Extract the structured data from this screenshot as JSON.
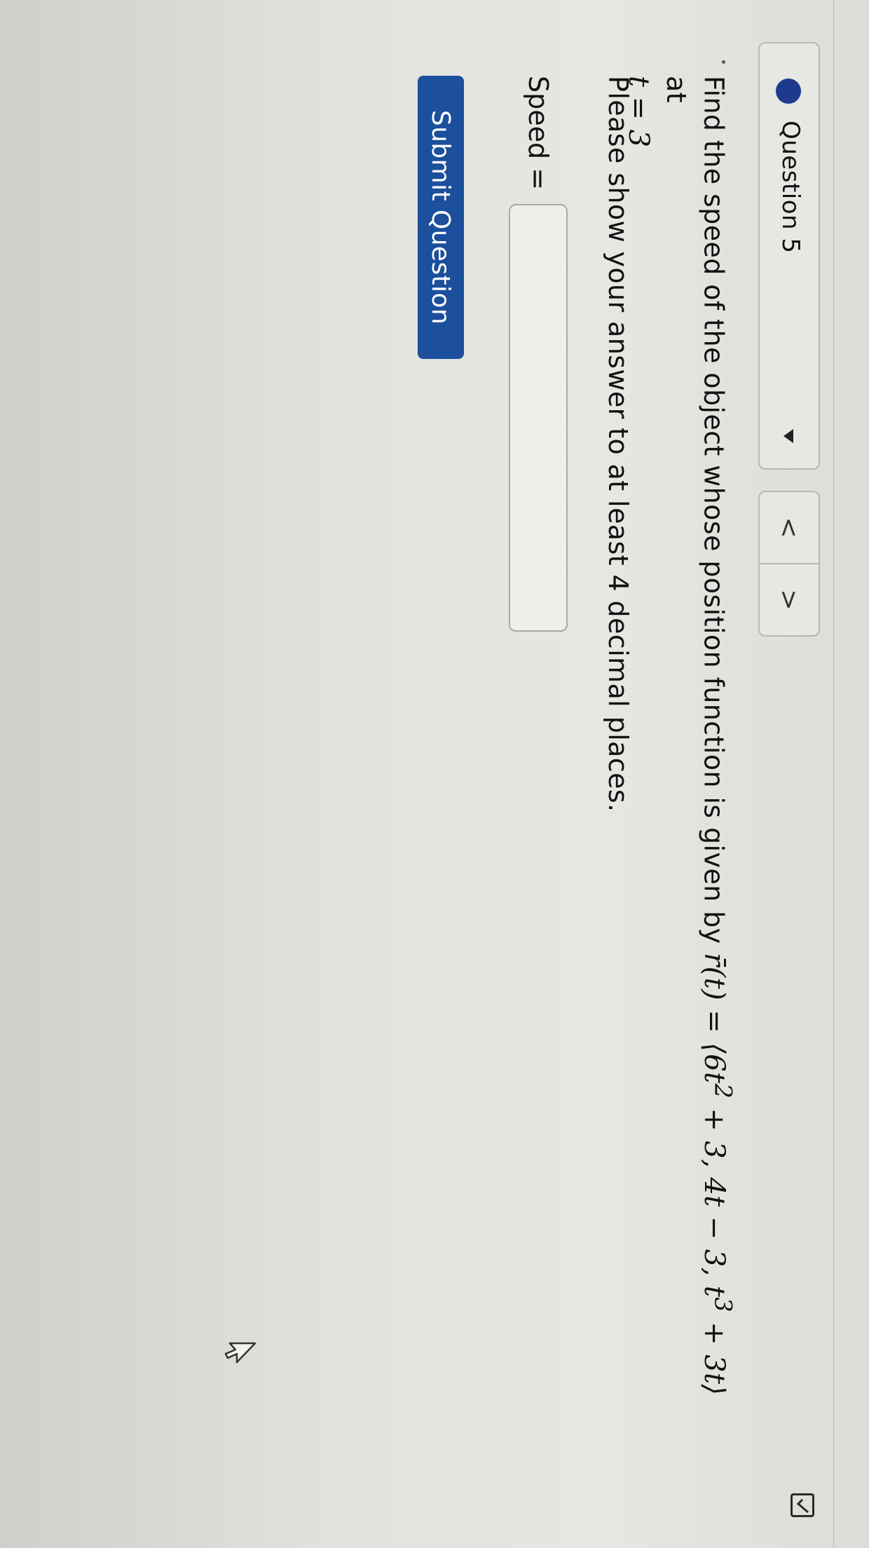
{
  "question_nav": {
    "question_label": "Question 5",
    "status_color": "#1d3a8f",
    "prev_label": "<",
    "next_label": ">"
  },
  "question": {
    "prompt_prefix": "Find the speed of the object whose position function is given by",
    "r_vector": "r̄",
    "math_func": "(t) = ⟨6t",
    "exp_2": "2",
    "math_mid": " + 3, 4t − 3, t",
    "exp_3": "3",
    "math_end": " + 3t⟩",
    "prompt_at": "at",
    "t_value": "t = 3",
    "instructions": "Please show your answer to at least 4 decimal places."
  },
  "answer": {
    "label": "Speed =",
    "value": ""
  },
  "submit_label": "Submit Question",
  "accent_color": "#1c4f9c"
}
